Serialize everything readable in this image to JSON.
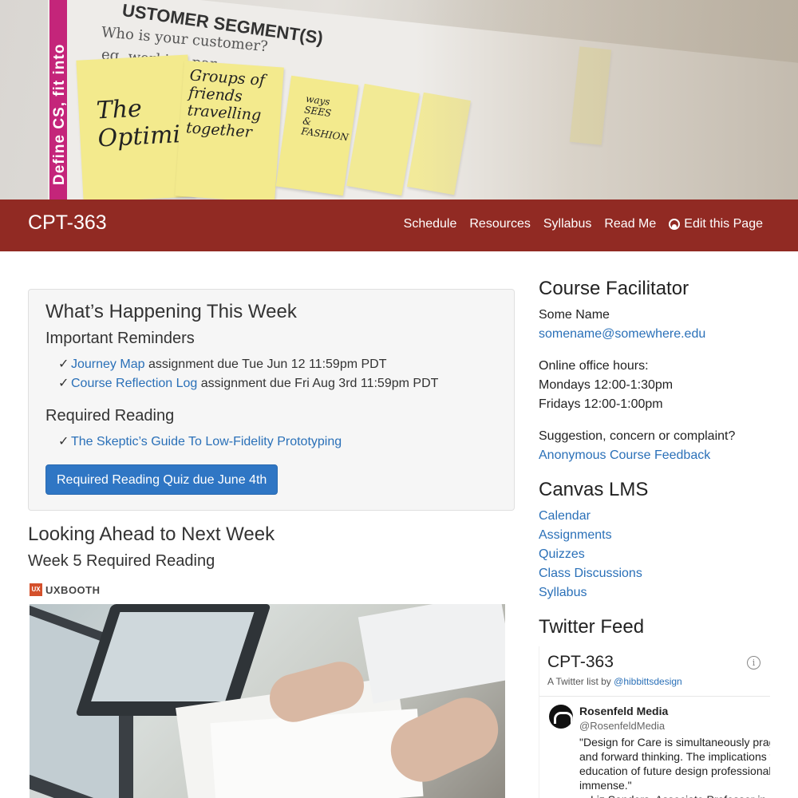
{
  "hero": {
    "vertical_text": "Define CS, fit into",
    "title": "USTOMER SEGMENT(S)",
    "subtitle": "Who is your customer?",
    "subtitle2": "eg. working par",
    "notes": [
      "The\nOptimizer",
      "Groups of\nfriends\ntravelling\ntogether",
      "ways\nSEES\n&\nFASHION"
    ]
  },
  "navbar": {
    "brand": "CPT-363",
    "links": [
      "Schedule",
      "Resources",
      "Syllabus",
      "Read Me",
      "Edit this Page"
    ],
    "edit_icon": "github-icon"
  },
  "this_week": {
    "title": "What’s Happening This Week",
    "reminders_heading": "Important Reminders",
    "reminders": [
      {
        "link": "Journey Map",
        "text": " assignment due Tue Jun 12 11:59pm PDT"
      },
      {
        "link": "Course Reflection Log",
        "text": " assignment due Fri Aug 3rd 11:59pm PDT"
      }
    ],
    "reading_heading": "Required Reading",
    "reading": [
      {
        "link": "The Skeptic’s Guide To Low-Fidelity Prototyping"
      }
    ],
    "check": "✓",
    "quiz_button": "Required Reading Quiz due June 4th"
  },
  "next_week": {
    "title": "Looking Ahead to Next Week",
    "subtitle": "Week 5 Required Reading",
    "source_logo": "UX",
    "source_name": "UXBOOTH"
  },
  "sidebar": {
    "facilitator_heading": "Course Facilitator",
    "name": "Some Name",
    "email": "somename@somewhere.edu",
    "office_hours_label": "Online office hours:",
    "office_hours": [
      "Mondays 12:00-1:30pm",
      "Fridays 12:00-1:00pm"
    ],
    "feedback_prompt": "Suggestion, concern or complaint?",
    "feedback_link": "Anonymous Course Feedback",
    "canvas_heading": "Canvas LMS",
    "canvas_links": [
      "Calendar",
      "Assignments",
      "Quizzes",
      "Class Discussions",
      "Syllabus"
    ],
    "twitter_heading": "Twitter Feed"
  },
  "twitter": {
    "list_title": "CPT-363",
    "byline_prefix": "A Twitter list by ",
    "byline_handle": "@hibbittsdesign",
    "tweet_name": "Rosenfeld Media",
    "tweet_handle": "@RosenfeldMedia",
    "tweet_text": "\"Design for Care is simultaneously prag\nand forward thinking. The implications f\neducation of future design professional\nimmense.\"\n—Liz Sanders, Associate Professor in D"
  },
  "colors": {
    "navbar": "#912a23",
    "link": "#2a70b8",
    "button": "#2f76c4"
  }
}
